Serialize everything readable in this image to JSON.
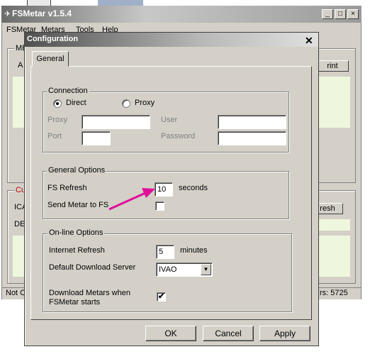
{
  "background_window": {
    "title": "FSMetar v1.5.4",
    "menu": [
      "FSMetar",
      "Metars",
      "Tools",
      "Help"
    ],
    "group_label_top": "ME",
    "left_letter_a": "A",
    "print_button": "rint",
    "group_label_cur": "Cu",
    "label_ica": "ICA",
    "label_de": "DE",
    "refresh_button": "resh",
    "status_left": "Not C",
    "status_right": "rs: 5725"
  },
  "dialog": {
    "title": "Configuration",
    "tab": "General",
    "connection": {
      "title": "Connection",
      "radio_direct": "Direct",
      "radio_proxy": "Proxy",
      "selected": "Direct",
      "proxy_label": "Proxy",
      "port_label": "Port",
      "user_label": "User",
      "password_label": "Password"
    },
    "general_options": {
      "title": "General Options",
      "fs_refresh_label": "FS Refresh",
      "fs_refresh_value": "10",
      "fs_refresh_unit": "seconds",
      "send_metar_label": "Send Metar to FS",
      "send_metar_checked": false
    },
    "online_options": {
      "title": "On-line Options",
      "internet_refresh_label": "Internet Refresh",
      "internet_refresh_value": "5",
      "internet_refresh_unit": "minutes",
      "download_server_label": "Default Download Server",
      "download_server_value": "IVAO",
      "download_on_start_label_line1": "Download Metars when",
      "download_on_start_label_line2": "FSMetar starts",
      "download_on_start_checked": true
    },
    "buttons": {
      "ok": "OK",
      "cancel": "Cancel",
      "apply": "Apply"
    }
  },
  "annotation": {
    "arrow_color": "#e0109a"
  }
}
